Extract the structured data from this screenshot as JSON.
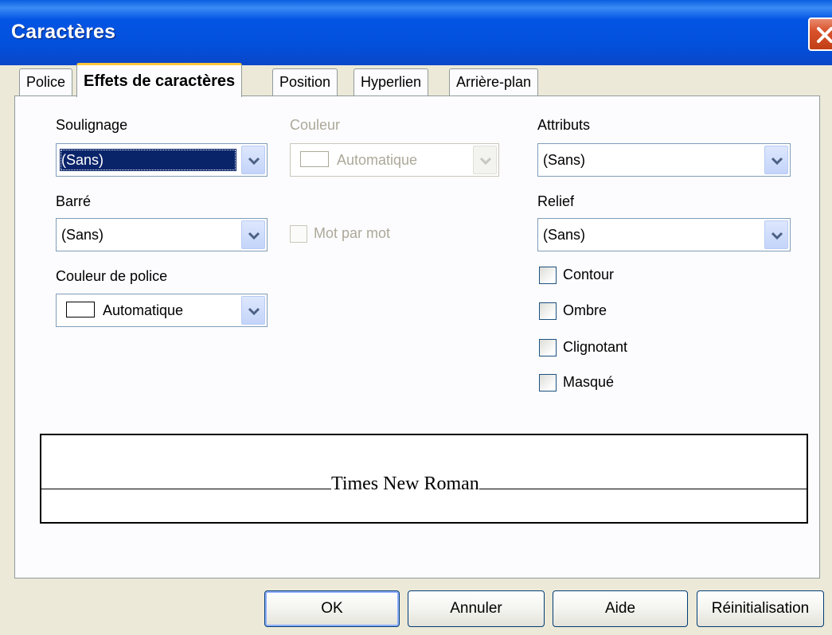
{
  "window": {
    "title": "Caractères"
  },
  "tabs": [
    {
      "label": "Police"
    },
    {
      "label": "Effets de caractères",
      "active": true
    },
    {
      "label": "Position"
    },
    {
      "label": "Hyperlien"
    },
    {
      "label": "Arrière-plan"
    }
  ],
  "left": {
    "soulignage_label": "Soulignage",
    "soulignage_value": "(Sans)",
    "barre_label": "Barré",
    "barre_value": "(Sans)",
    "couleur_police_label": "Couleur de police",
    "couleur_police_value": "Automatique"
  },
  "middle": {
    "couleur_label": "Couleur",
    "couleur_value": "Automatique",
    "mot_par_mot_label": "Mot par mot"
  },
  "right": {
    "attributs_label": "Attributs",
    "attributs_value": "(Sans)",
    "relief_label": "Relief",
    "relief_value": "(Sans)",
    "checkboxes": [
      {
        "label": "Contour",
        "checked": false
      },
      {
        "label": "Ombre",
        "checked": false
      },
      {
        "label": "Clignotant",
        "checked": false
      },
      {
        "label": "Masqué",
        "checked": false
      }
    ]
  },
  "preview": {
    "text": "Times New Roman"
  },
  "buttons": {
    "ok": "OK",
    "annuler": "Annuler",
    "aide": "Aide",
    "reinitialisation": "Réinitialisation"
  },
  "colors": {
    "title_bar": "#0454e4",
    "selection": "#0a246a",
    "dialog_bg": "#ece9d8",
    "tab_accent": "#ffc83c"
  }
}
